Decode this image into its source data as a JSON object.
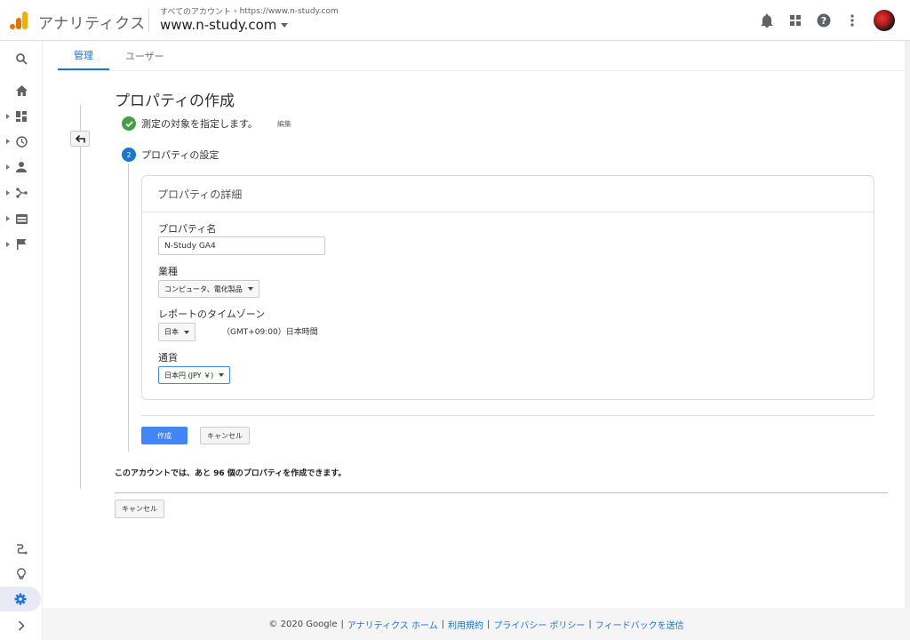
{
  "app": {
    "name": "アナリティクス"
  },
  "header": {
    "breadcrumb_all": "すべてのアカウント",
    "breadcrumb_account": "https://www.n-study.com",
    "property": "www.n-study.com"
  },
  "tabs": [
    {
      "label": "管理"
    },
    {
      "label": "ユーザー"
    }
  ],
  "page": {
    "title": "プロパティの作成",
    "step1_label": "測定の対象を指定します。",
    "step1_edit": "編集",
    "step2_number": "2",
    "step2_label": "プロパティの設定"
  },
  "card": {
    "title": "プロパティの詳細",
    "property_name_label": "プロパティ名",
    "property_name_value": "N-Study GA4",
    "industry_label": "業種",
    "industry_value": "コンピュータ、電化製品",
    "timezone_label": "レポートのタイムゾーン",
    "timezone_country": "日本",
    "timezone_value": "（GMT+09:00）日本時間",
    "currency_label": "通貨",
    "currency_value": "日本円 (JPY ￥)"
  },
  "actions": {
    "create": "作成",
    "cancel": "キャンセル",
    "cancel_bottom": "キャンセル"
  },
  "note": "このアカウントでは、あと 96 個のプロパティを作成できます。",
  "footer": {
    "copyright": "© 2020 Google",
    "links": [
      "アナリティクス ホーム",
      "利用規約",
      "プライバシー ポリシー",
      "フィードバックを送信"
    ]
  },
  "icons": {
    "top": [
      "bell-icon",
      "apps-icon",
      "help-icon",
      "more-vert-icon"
    ],
    "nav": [
      "search-icon",
      "home-icon",
      "dashboard-icon",
      "clock-icon",
      "person-icon",
      "acquisition-icon",
      "behavior-icon",
      "flag-icon",
      "attribution-icon",
      "lightbulb-icon",
      "gear-icon",
      "expand-icon"
    ]
  },
  "colors": {
    "accent": "#1a73e8",
    "primary_button": "#4285f4",
    "success": "#43a047",
    "step": "#1976d2"
  }
}
